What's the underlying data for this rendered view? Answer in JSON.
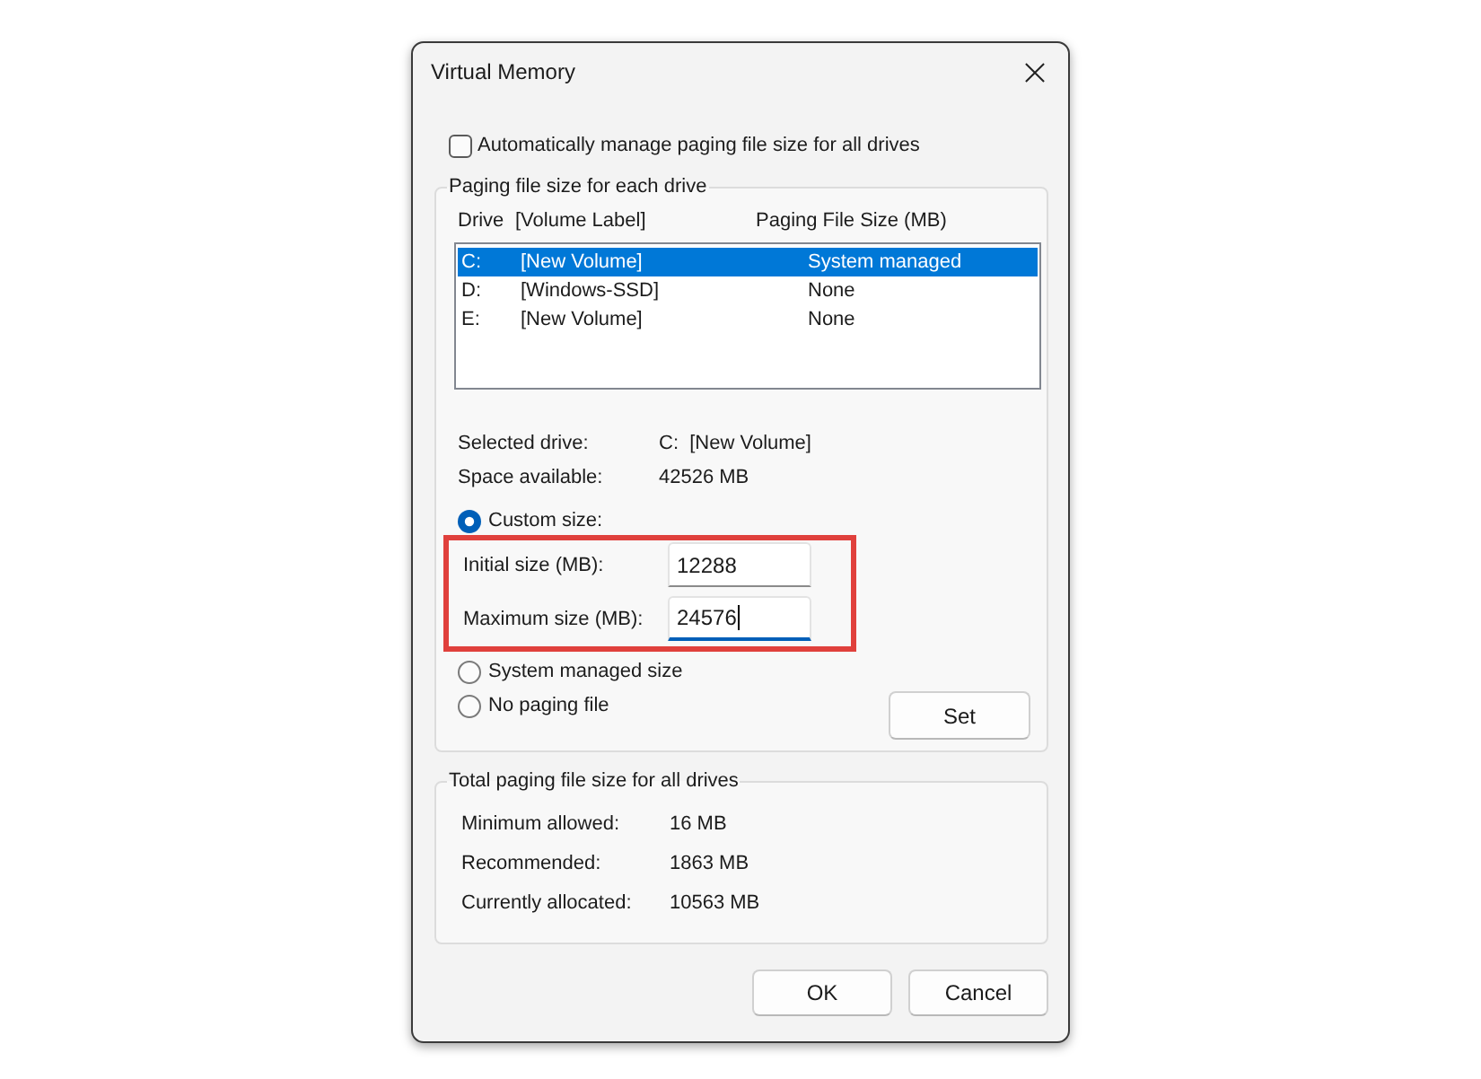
{
  "window": {
    "title": "Virtual Memory"
  },
  "auto_manage": {
    "label": "Automatically manage paging file size for all drives",
    "checked": false
  },
  "drive_group": {
    "title": "Paging file size for each drive",
    "columns": [
      "Drive",
      "[Volume Label]",
      "Paging File Size (MB)"
    ],
    "rows": [
      {
        "drive": "C:",
        "volume_label": "[New Volume]",
        "paging_file_size": "System managed",
        "selected": true
      },
      {
        "drive": "D:",
        "volume_label": "[Windows-SSD]",
        "paging_file_size": "None",
        "selected": false
      },
      {
        "drive": "E:",
        "volume_label": "[New Volume]",
        "paging_file_size": "None",
        "selected": false
      }
    ],
    "selected_drive": {
      "label": "Selected drive:",
      "value": "C:  [New Volume]"
    },
    "space_available": {
      "label": "Space available:",
      "value": "42526 MB"
    },
    "size_options": [
      {
        "label": "Custom size:",
        "selected": true
      },
      {
        "label": "System managed size",
        "selected": false
      },
      {
        "label": "No paging file",
        "selected": false
      }
    ],
    "custom_fields": {
      "highlighted": true,
      "fields": [
        {
          "label": "Initial size (MB):",
          "value": "12288",
          "focused": false
        },
        {
          "label": "Maximum size (MB):",
          "value": "24576",
          "focused": true
        }
      ]
    },
    "set_button": {
      "label": "Set"
    }
  },
  "totals_group": {
    "title": "Total paging file size for all drives",
    "rows": [
      {
        "label": "Minimum allowed:",
        "value": "16 MB"
      },
      {
        "label": "Recommended:",
        "value": "1863 MB"
      },
      {
        "label": "Currently allocated:",
        "value": "10563 MB"
      }
    ]
  },
  "buttons": [
    {
      "label": "OK"
    },
    {
      "label": "Cancel"
    }
  ]
}
